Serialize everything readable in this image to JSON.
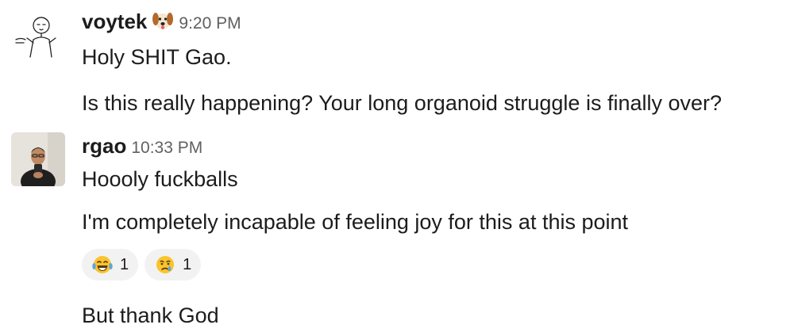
{
  "messages": [
    {
      "user": "voytek",
      "user_status_icon": "dog-face-icon",
      "time": "9:20 PM",
      "lines": [
        "Holy SHIT Gao.",
        "Is this really happening? Your long organoid struggle is finally over?"
      ]
    },
    {
      "user": "rgao",
      "time": "10:33 PM",
      "lines": [
        "Hoooly fuckballs",
        "I'm completely incapable of feeling joy for this at this point",
        "But thank God"
      ],
      "reactions": [
        {
          "icon": "laughing-tears-emoji-icon",
          "count": "1"
        },
        {
          "icon": "crying-face-emoji-icon",
          "count": "1"
        }
      ]
    }
  ]
}
